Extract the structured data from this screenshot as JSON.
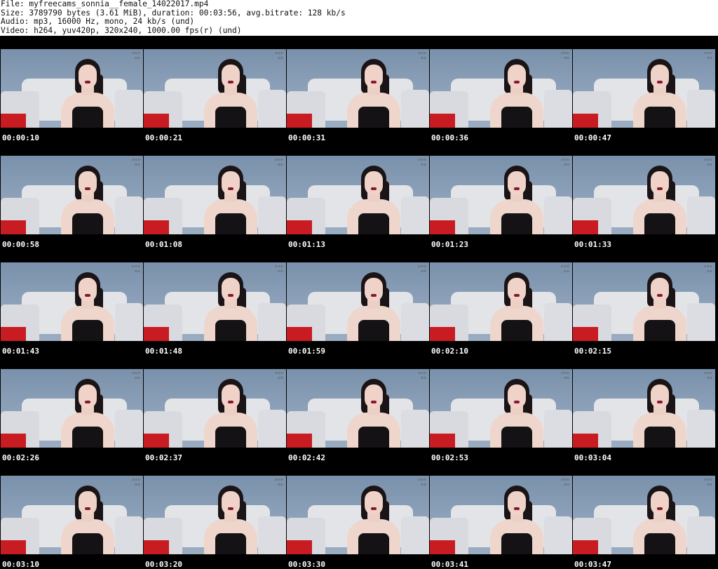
{
  "file_info": {
    "line_file": "File: myfreecams_sonnia__female_14022017.mp4",
    "line_size": "Size: 3789790 bytes (3.61 MiB), duration: 00:03:56, avg.bitrate: 128 kb/s",
    "line_audio": "Audio: mp3, 16000 Hz, mono, 24 kb/s (und)",
    "line_video": "Video: h264, yuv420p, 320x240, 1000.00 fps(r) (und)"
  },
  "thumbnails": [
    "00:00:10",
    "00:00:21",
    "00:00:31",
    "00:00:36",
    "00:00:47",
    "00:00:58",
    "00:01:08",
    "00:01:13",
    "00:01:23",
    "00:01:33",
    "00:01:43",
    "00:01:48",
    "00:01:59",
    "00:02:10",
    "00:02:15",
    "00:02:26",
    "00:02:37",
    "00:02:42",
    "00:02:53",
    "00:03:04",
    "00:03:10",
    "00:03:20",
    "00:03:30",
    "00:03:41",
    "00:03:47"
  ],
  "colors": {
    "sheet_background": "#000000",
    "timestamp_text": "#ffffff",
    "wall": "#8ea2ba",
    "sofa": "#e3e4e8",
    "cushion": "#c81c22"
  }
}
